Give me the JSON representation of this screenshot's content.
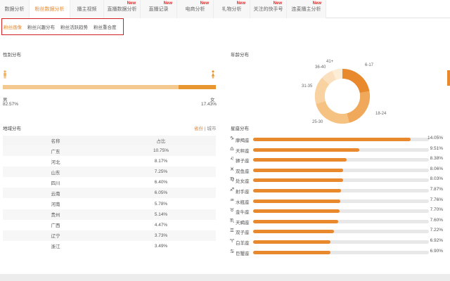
{
  "top_tabs": [
    {
      "label": "数据分析",
      "new": ""
    },
    {
      "label": "粉丝数据分析",
      "new": ""
    },
    {
      "label": "播主视频",
      "new": ""
    },
    {
      "label": "直播数据分析",
      "new": "New"
    },
    {
      "label": "直播记录",
      "new": "New"
    },
    {
      "label": "电商分析",
      "new": "New"
    },
    {
      "label": "礼物分析",
      "new": "New"
    },
    {
      "label": "关注的快手号",
      "new": "New"
    },
    {
      "label": "连麦播主分析",
      "new": "New"
    }
  ],
  "sub_tabs": [
    "粉丝画像",
    "粉丝兴趣分布",
    "粉丝活跃趋势",
    "粉丝重合度"
  ],
  "gender": {
    "title": "性别分布",
    "male_label": "男",
    "female_label": "女",
    "male_pct": "82.57%",
    "female_pct": "17.43%",
    "female_fraction": 0.1743,
    "male_color": "#e8962f",
    "female_color": "#e8962f"
  },
  "age": {
    "title": "年龄分布",
    "labels": [
      "6-17",
      "18-24",
      "25-30",
      "31-35",
      "36-40",
      "41+"
    ]
  },
  "region": {
    "title": "地域分布",
    "switch_province": "省份",
    "switch_sep": "|",
    "switch_city": "城市",
    "col_name": "名称",
    "col_value": "占比",
    "rows": [
      {
        "name": "广东",
        "value": "10.75%"
      },
      {
        "name": "河北",
        "value": "8.17%"
      },
      {
        "name": "山东",
        "value": "7.25%"
      },
      {
        "name": "四川",
        "value": "6.40%"
      },
      {
        "name": "云南",
        "value": "6.05%"
      },
      {
        "name": "河南",
        "value": "5.78%"
      },
      {
        "name": "贵州",
        "value": "5.14%"
      },
      {
        "name": "广西",
        "value": "4.47%"
      },
      {
        "name": "辽宁",
        "value": "3.73%"
      },
      {
        "name": "浙江",
        "value": "3.49%"
      }
    ]
  },
  "zodiac": {
    "title": "星座分布",
    "max": 14.05,
    "accent": "#e8892e",
    "rows": [
      {
        "name": "摩羯座",
        "icon": "♑",
        "value": 14.05,
        "label": "14.05%"
      },
      {
        "name": "天秤座",
        "icon": "♎",
        "value": 9.51,
        "label": "9.51%"
      },
      {
        "name": "狮子座",
        "icon": "♌",
        "value": 8.38,
        "label": "8.38%"
      },
      {
        "name": "双鱼座",
        "icon": "♓",
        "value": 8.06,
        "label": "8.06%"
      },
      {
        "name": "处女座",
        "icon": "♍",
        "value": 8.03,
        "label": "8.03%"
      },
      {
        "name": "射手座",
        "icon": "♐",
        "value": 7.87,
        "label": "7.87%"
      },
      {
        "name": "水瓶座",
        "icon": "♒",
        "value": 7.76,
        "label": "7.76%"
      },
      {
        "name": "金牛座",
        "icon": "♉",
        "value": 7.7,
        "label": "7.70%"
      },
      {
        "name": "天蝎座",
        "icon": "♏",
        "value": 7.6,
        "label": "7.60%"
      },
      {
        "name": "双子座",
        "icon": "♊",
        "value": 7.22,
        "label": "7.22%"
      },
      {
        "name": "白羊座",
        "icon": "♈",
        "value": 6.92,
        "label": "6.92%"
      },
      {
        "name": "巨蟹座",
        "icon": "♋",
        "value": 6.9,
        "label": "6.90%"
      }
    ]
  }
}
